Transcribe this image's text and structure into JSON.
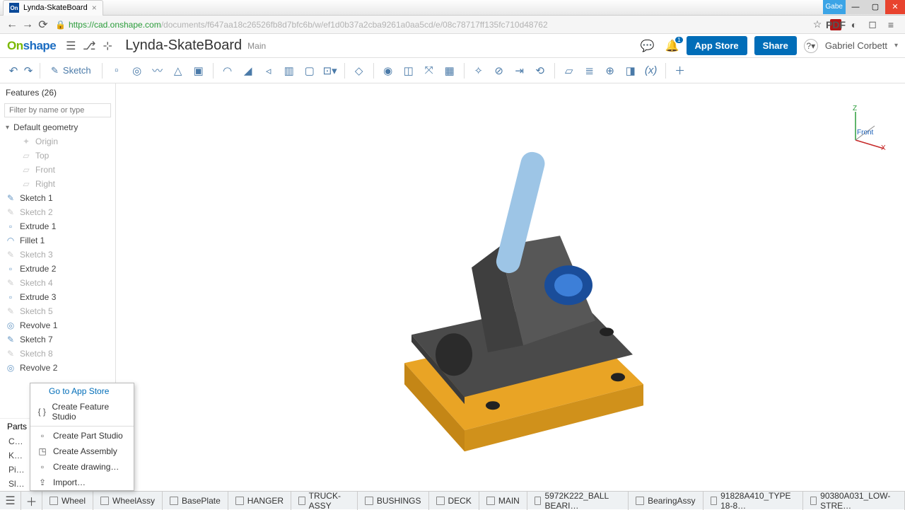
{
  "browser": {
    "tab_title": "Lynda-SkateBoard",
    "user_tag": "Gabe",
    "url_secure": "https",
    "url_host": "://cad.onshape.com",
    "url_path": "/documents/f647aa18c26526fb8d7bfc6b/w/ef1d0b37a2cba9261a0aa5cd/e/08c78717ff135fc710d48762"
  },
  "header": {
    "logo_a": "On",
    "logo_b": "shape",
    "doc_title": "Lynda-SkateBoard",
    "doc_sub": "Main",
    "appstore": "App Store",
    "share": "Share",
    "user": "Gabriel Corbett",
    "notif_count": "1"
  },
  "toolbar": {
    "sketch": "Sketch"
  },
  "sidebar": {
    "features_header": "Features (26)",
    "filter_placeholder": "Filter by name or type",
    "default_geom": "Default geometry",
    "origin": "Origin",
    "planes": [
      "Top",
      "Front",
      "Right"
    ],
    "features": [
      {
        "label": "Sketch 1",
        "dim": false,
        "icon": "pencil"
      },
      {
        "label": "Sketch 2",
        "dim": true,
        "icon": "pencil"
      },
      {
        "label": "Extrude 1",
        "dim": false,
        "icon": "cube"
      },
      {
        "label": "Fillet 1",
        "dim": false,
        "icon": "fillet"
      },
      {
        "label": "Sketch 3",
        "dim": true,
        "icon": "pencil"
      },
      {
        "label": "Extrude 2",
        "dim": false,
        "icon": "cube"
      },
      {
        "label": "Sketch 4",
        "dim": true,
        "icon": "pencil"
      },
      {
        "label": "Extrude 3",
        "dim": false,
        "icon": "cube"
      },
      {
        "label": "Sketch 5",
        "dim": true,
        "icon": "pencil"
      },
      {
        "label": "Revolve 1",
        "dim": false,
        "icon": "rev"
      },
      {
        "label": "Sketch 7",
        "dim": false,
        "icon": "pencil"
      },
      {
        "label": "Sketch 8",
        "dim": true,
        "icon": "pencil"
      },
      {
        "label": "Revolve 2",
        "dim": false,
        "icon": "rev"
      }
    ],
    "parts_header": "Parts",
    "parts_cut": [
      "C…",
      "K…",
      "Pi…",
      "Sl…"
    ]
  },
  "context_menu": {
    "goto": "Go to App Store",
    "items": [
      "Create Feature Studio",
      "Create Part Studio",
      "Create Assembly",
      "Create drawing…",
      "Import…"
    ]
  },
  "tabs": [
    "Wheel",
    "WheelAssy",
    "BasePlate",
    "HANGER",
    "TRUCK-ASSY",
    "BUSHINGS",
    "DECK",
    "MAIN",
    "5972K222_BALL BEARI…",
    "BearingAssy",
    "91828A410_TYPE 18-8…",
    "90380A031_LOW-STRE…"
  ],
  "gizmo": {
    "z": "Z",
    "x": "X",
    "front": "Front"
  }
}
